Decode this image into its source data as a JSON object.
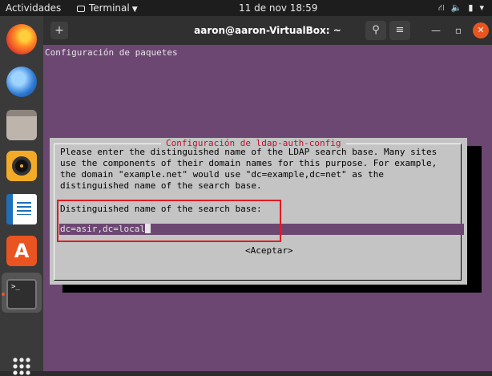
{
  "topbar": {
    "activities": "Actividades",
    "app_menu": "Terminal",
    "clock": "11 de nov  18:59",
    "tray_network_icon": "network-icon",
    "tray_volume_icon": "volume-icon",
    "tray_battery_icon": "battery-icon",
    "tray_menu_icon": "chevron-down-icon"
  },
  "dock": {
    "items": [
      "firefox-icon",
      "thunderbird-icon",
      "files-icon",
      "rhythmbox-icon",
      "writer-icon",
      "software-icon",
      "terminal-icon",
      "app-grid-icon"
    ],
    "terminal_glyph": ">_"
  },
  "window": {
    "title": "aaron@aaron-VirtualBox: ~",
    "new_tab_glyph": "+",
    "menu_glyph": "≡"
  },
  "terminal": {
    "heading": "Configuración de paquetes",
    "dialog": {
      "title": "Configuración de ldap-auth-config",
      "message": "Please enter the distinguished name of the LDAP search base. Many sites\nuse the components of their domain names for this purpose. For example,\nthe domain \"example.net\" would use \"dc=example,dc=net\" as the\ndistinguished name of the search base.",
      "field_label": "Distinguished name of the search base:",
      "field_value": "dc=asir,dc=local",
      "accept_button": "<Aceptar>"
    }
  },
  "colors": {
    "terminal_bg": "#6c4772",
    "dialog_bg": "#c4c4c4",
    "dialog_title": "#c0102a",
    "highlight": "#e01b24",
    "close_button": "#e95420"
  }
}
